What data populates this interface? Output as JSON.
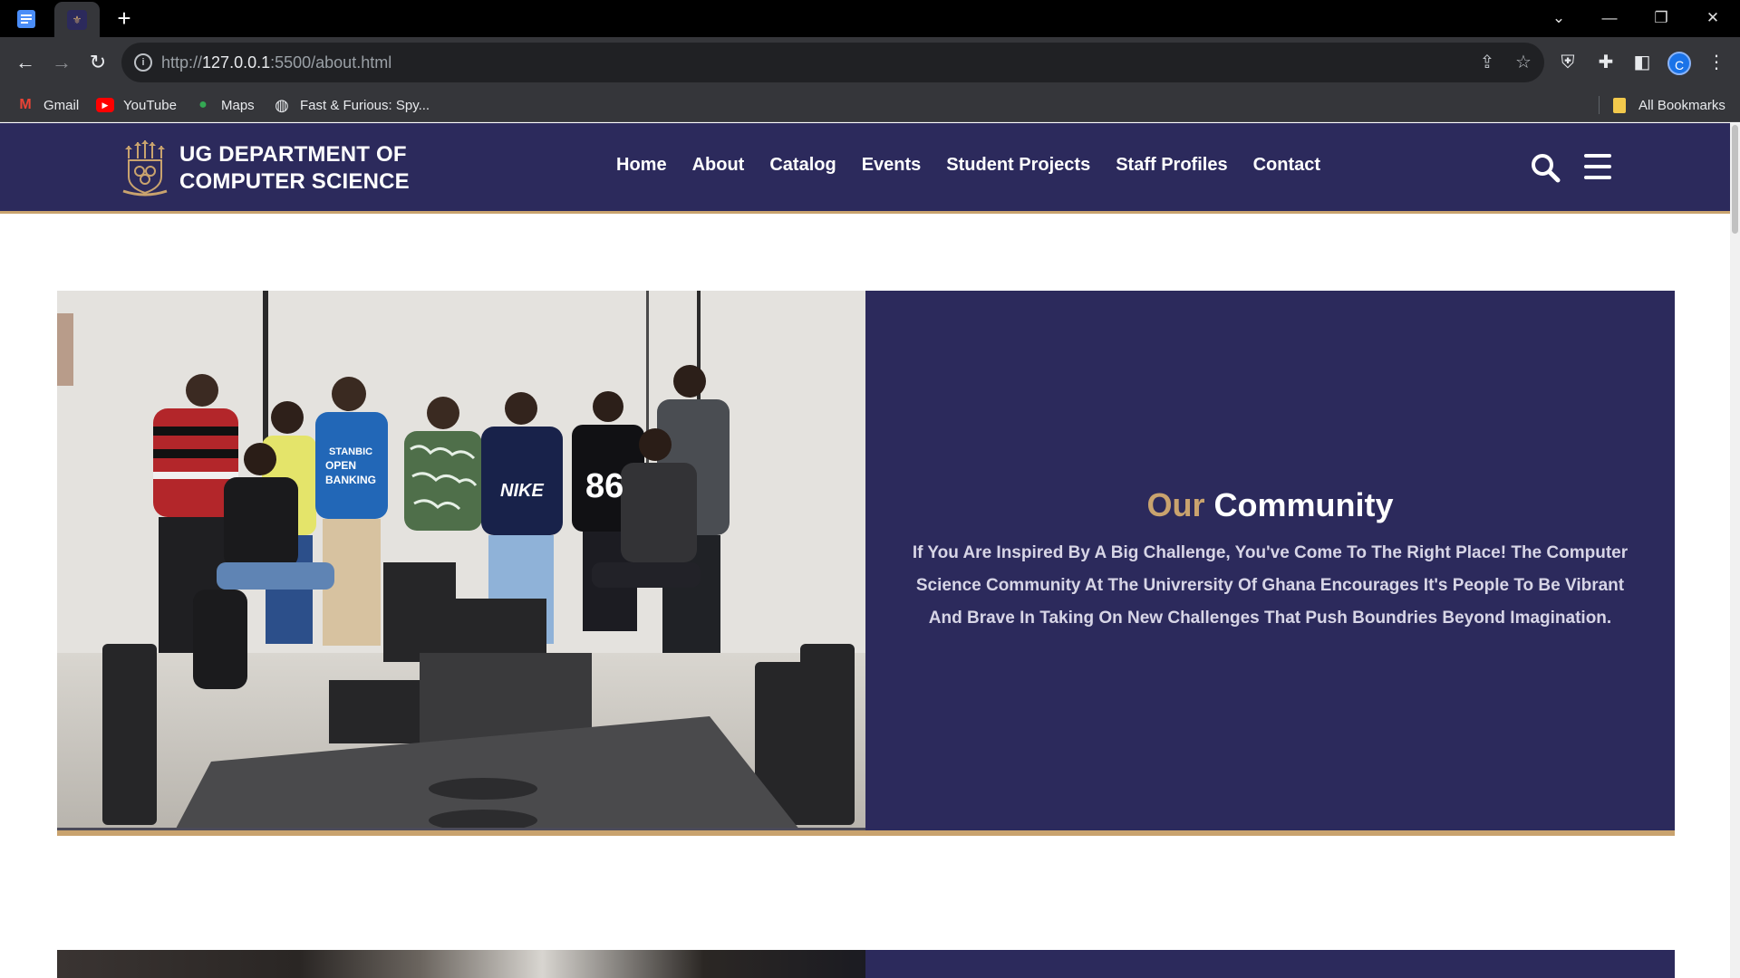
{
  "browser": {
    "url_prefix": "http://",
    "url_host": "127.0.0.1",
    "url_rest": ":5500/about.html",
    "bookmarks": [
      {
        "label": "Gmail",
        "icon": "gmail-icon"
      },
      {
        "label": "YouTube",
        "icon": "youtube-icon"
      },
      {
        "label": "Maps",
        "icon": "maps-icon"
      },
      {
        "label": "Fast & Furious: Spy...",
        "icon": "globe-icon"
      }
    ],
    "all_bookmarks": "All Bookmarks",
    "profile_initial": "C"
  },
  "site": {
    "title_line1": "UG DEPARTMENT OF",
    "title_line2": "COMPUTER SCIENCE",
    "nav": [
      "Home",
      "About",
      "Catalog",
      "Events",
      "Student Projects",
      "Staff Profiles",
      "Contact"
    ],
    "colors": {
      "primary": "#2c2a5c",
      "accent": "#c9a36e"
    }
  },
  "community": {
    "title_accent": "Our",
    "title_main": "Community",
    "body": "If You Are Inspired By A Big Challenge, You've Come To The Right Place! The Computer Science Community At The Univrersity Of Ghana Encourages It's People To Be Vibrant And Brave In Taking On New Challenges That Push Boundries Beyond Imagination.",
    "photo_text": {
      "shirt": [
        "STANBIC",
        "OPEN",
        "BANKING"
      ],
      "nike": "NIKE",
      "jersey": "86"
    }
  }
}
